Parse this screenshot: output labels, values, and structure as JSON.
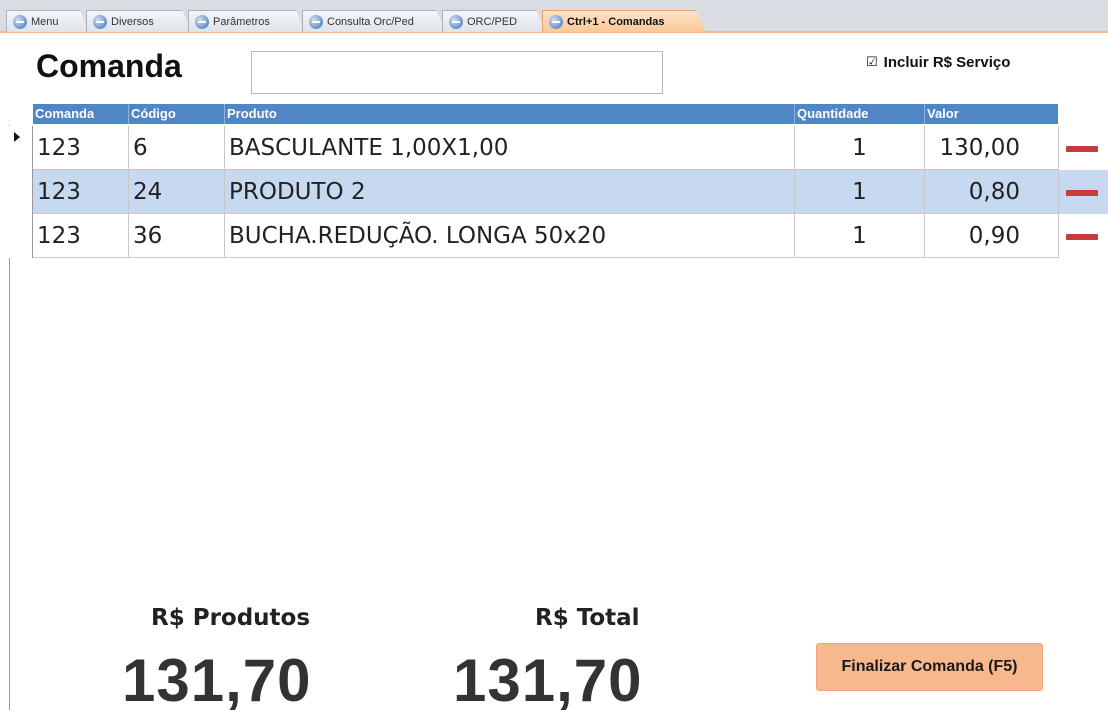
{
  "tabs": [
    {
      "label": "Menu",
      "active": false
    },
    {
      "label": "Diversos",
      "active": false
    },
    {
      "label": "Parâmetros",
      "active": false
    },
    {
      "label": "Consulta Orc/Ped",
      "active": false
    },
    {
      "label": "ORC/PED",
      "active": false
    },
    {
      "label": "Ctrl+1 - Comandas",
      "active": true
    }
  ],
  "header": {
    "title": "Comanda",
    "search_value": "",
    "include_service_label": "Incluir R$ Serviço",
    "include_service_checked": true
  },
  "table": {
    "columns": [
      "Comanda",
      "Código",
      "Produto",
      "Quantidade",
      "Valor"
    ],
    "rows": [
      {
        "comanda": "123",
        "codigo": "6",
        "produto": "BASCULANTE 1,00X1,00",
        "quantidade": "1",
        "valor": "130,00"
      },
      {
        "comanda": "123",
        "codigo": "24",
        "produto": "PRODUTO 2",
        "quantidade": "1",
        "valor": "0,80"
      },
      {
        "comanda": "123",
        "codigo": "36",
        "produto": "BUCHA.REDUÇÃO. LONGA 50x20",
        "quantidade": "1",
        "valor": "0,90"
      }
    ]
  },
  "totals": {
    "produtos_label": "R$ Produtos",
    "produtos_value": "131,70",
    "total_label": "R$ Total",
    "total_value": "131,70"
  },
  "finish_button": "Finalizar Comanda (F5)",
  "colors": {
    "header_blue": "#4f86c6",
    "row_highlight": "#c7d9f0",
    "active_tab": "#f9c896",
    "delete_red": "#c93a3a",
    "finish_button": "#f7b88e"
  }
}
